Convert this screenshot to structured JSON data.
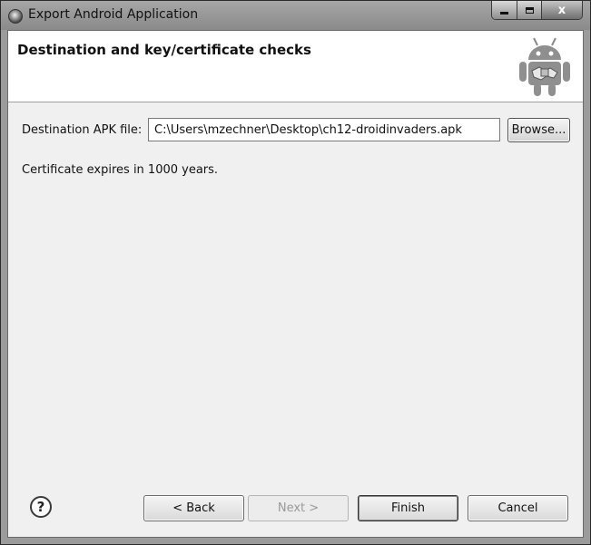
{
  "window": {
    "title": "Export Android Application",
    "controls": {
      "minimize": "minimize",
      "maximize": "maximize",
      "close": "x"
    }
  },
  "header": {
    "title": "Destination and key/certificate checks",
    "logo_icon": "android-robot-icon"
  },
  "form": {
    "destination_label": "Destination APK file:",
    "destination_value": "C:\\Users\\mzechner\\Desktop\\ch12-droidinvaders.apk",
    "browse_label": "Browse...",
    "certificate_message": "Certificate expires in 1000 years."
  },
  "footer": {
    "help_icon": "help-icon",
    "help_glyph": "?",
    "buttons": {
      "back": "< Back",
      "next": "Next >",
      "finish": "Finish",
      "cancel": "Cancel"
    }
  }
}
